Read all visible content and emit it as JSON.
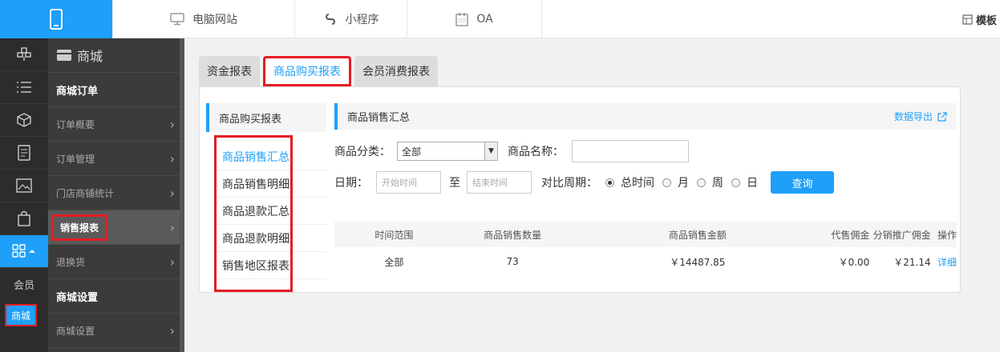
{
  "topbar": {
    "tabs": [
      {
        "label": "电脑网站",
        "icon": "monitor-icon"
      },
      {
        "label": "小程序",
        "icon": "mini-program-icon"
      },
      {
        "label": "OA",
        "icon": "calendar-icon"
      }
    ],
    "right_label": "模板"
  },
  "iconcol": {
    "member_label": "会员",
    "mall_label": "商城"
  },
  "sidebar": {
    "header": "商城",
    "section1": "商城订单",
    "items": [
      {
        "label": "订单概要"
      },
      {
        "label": "订单管理"
      },
      {
        "label": "门店商铺统计"
      },
      {
        "label": "销售报表"
      },
      {
        "label": "退换货"
      }
    ],
    "section2": "商城设置",
    "settings_item": "商城设置"
  },
  "tabs": [
    "资金报表",
    "商品购买报表",
    "会员消费报表"
  ],
  "subnav": {
    "title": "商品购买报表",
    "items": [
      "商品销售汇总",
      "商品销售明细",
      "商品退款汇总",
      "商品退款明细",
      "销售地区报表"
    ]
  },
  "content": {
    "title": "商品销售汇总",
    "export_label": "数据导出",
    "category_label": "商品分类：",
    "category_value": "全部",
    "name_label": "商品名称：",
    "date_label": "日期：",
    "start_placeholder": "开始时间",
    "to_label": "至",
    "end_placeholder": "结束时间",
    "period_label": "对比周期：",
    "period_options": [
      "总时间",
      "月",
      "周",
      "日"
    ],
    "query_button": "查询"
  },
  "table": {
    "headers": [
      "时间范围",
      "商品销售数量",
      "商品销售金额",
      "代售佣金",
      "分销推广佣金",
      "操作"
    ],
    "rows": [
      {
        "range": "全部",
        "qty": "73",
        "amount": "￥14487.85",
        "consign": "￥0.00",
        "promo": "￥21.14",
        "action": "详细"
      }
    ]
  }
}
